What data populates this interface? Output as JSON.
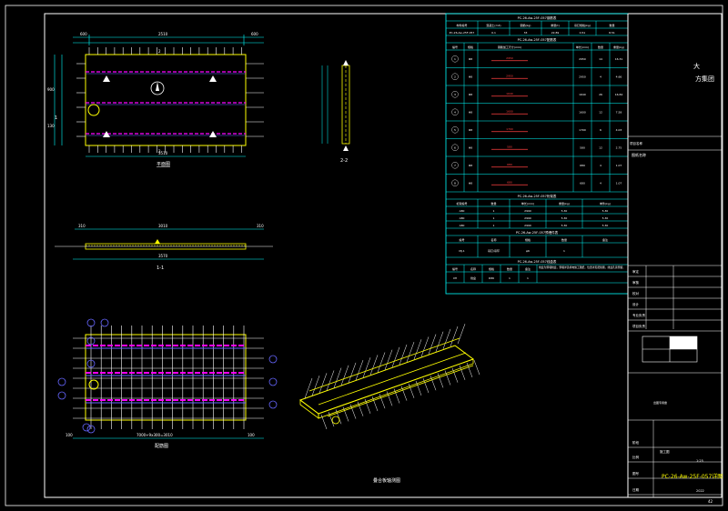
{
  "sheet": {
    "page_number": "42"
  },
  "views": {
    "plan_label": "平面图",
    "section_1_label": "1-1",
    "section_2_label": "2-2",
    "rebar_plan_label": "配筋图",
    "iso_label": "叠合板轴测图"
  },
  "dims": {
    "top_left": "600",
    "top_mid": "2510",
    "top_right": "600",
    "bottom": "3510",
    "left_1": "900",
    "left_2": "130",
    "left_total": "1740",
    "sec_left": "310",
    "sec_mid": "3010",
    "sec_right": "310",
    "sec_total": "3570",
    "rebar_bottom_left": "100",
    "rebar_bottom_mid": "7000+9x300=3010",
    "rebar_bottom_right": "100"
  },
  "table": {
    "title1": "PC-26-Aw-25F-057钢筋表",
    "head1": [
      "构件编号",
      "混凝土(m3)",
      "钢筋(kg)",
      "重量(t)",
      "吊钉规格(kg)",
      "数量"
    ],
    "row1": [
      "PC-26-Aw-25F-057",
      "0.1",
      "33",
      "22.89",
      "0.51",
      "8.51"
    ],
    "title2": "PC-26-Aw-25F-057配筋表",
    "head2": [
      "编号",
      "规格",
      "钢筋加工尺寸(mm)",
      "单长(mm)",
      "数量",
      "重量(kg)"
    ],
    "rows2": [
      [
        "1",
        "Φ8",
        "2950",
        "2950",
        "14",
        "16.31"
      ],
      [
        "2",
        "Φ8",
        "2950",
        "2950",
        "4",
        "4.66"
      ],
      [
        "3",
        "Φ8",
        "1640",
        "1640",
        "26",
        "16.84"
      ],
      [
        "4",
        "Φ8",
        "1600",
        "1600",
        "12",
        "7.58"
      ],
      [
        "5",
        "Φ8",
        "1700",
        "1700",
        "6",
        "4.03"
      ],
      [
        "6",
        "Φ8",
        "580",
        "580",
        "12",
        "2.75"
      ],
      [
        "7",
        "Φ8",
        "680",
        "680",
        "4",
        "1.07"
      ],
      [
        "8",
        "Φ8",
        "680",
        "680",
        "4",
        "1.07"
      ]
    ],
    "title3": "PC-26-Aw-25F-057桁架表",
    "head3": [
      "桁架编号",
      "数量",
      "单长(mm)",
      "重量(kg)",
      "单件(kg)"
    ],
    "rows3": [
      [
        "A80",
        "1",
        "2990",
        "5.30",
        "5.30"
      ],
      [
        "A80",
        "1",
        "2990",
        "5.30",
        "5.30"
      ],
      [
        "A80",
        "1",
        "2990",
        "5.30",
        "5.30"
      ]
    ],
    "title4": "PC-26-Aw-25F-057预埋件表",
    "head4": [
      "编号",
      "名称",
      "规格",
      "数量",
      "备注"
    ],
    "rows4": [
      [
        "MJ-1",
        "吊钉/吊环",
        "φ6",
        "1",
        ""
      ]
    ],
    "title5": "PC-26-Aw-25F-057线盒表",
    "head5": [
      "编号",
      "名称",
      "规格",
      "数量",
      "备注"
    ],
    "rows5": [
      [
        "XH",
        "线盒",
        "D86",
        "1",
        "1"
      ]
    ],
    "note": "线盒为预埋线盒，预埋详见机电施工图纸，位置详见配筋图，线盒孔需预留。"
  },
  "title_block": {
    "company": "大方集团",
    "project_label": "项目名称",
    "drawing_label": "图纸名称",
    "approved_label": "审定",
    "design_label": "设计",
    "check_label": "校对",
    "review_label": "审核",
    "chief_label": "专业负责",
    "leader_label": "项目负责",
    "stage_label": "阶段",
    "stage_value": "施工图",
    "scale_label": "比例",
    "scale_value": "1:25",
    "drawing_no_label": "图号",
    "drawing_no_value": "PC-26-Aw-25F-057详图",
    "date_label": "日期",
    "date_value": "2022",
    "seal_label": "出图专用章"
  },
  "colors": {
    "frame": "#ffffff",
    "dim": "#00ffff",
    "slab": "#ffff00",
    "rebar": "#ffffff",
    "truss": "#ff00ff",
    "table_line": "#00ffff",
    "table_text": "#ffffff",
    "red_dim": "#ff4040",
    "drawing_no": "#ffff00"
  }
}
